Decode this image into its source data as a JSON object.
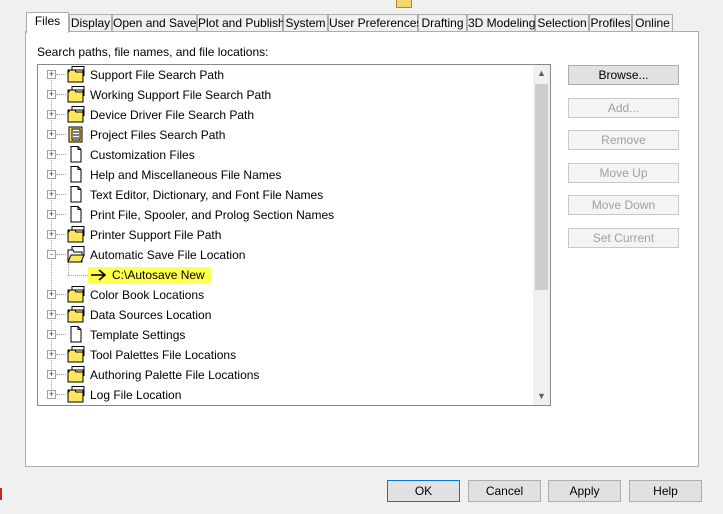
{
  "tabs": [
    {
      "label": "Files",
      "active": true
    },
    {
      "label": "Display",
      "active": false
    },
    {
      "label": "Open and Save",
      "active": false
    },
    {
      "label": "Plot and Publish",
      "active": false
    },
    {
      "label": "System",
      "active": false
    },
    {
      "label": "User Preferences",
      "active": false
    },
    {
      "label": "Drafting",
      "active": false
    },
    {
      "label": "3D Modeling",
      "active": false
    },
    {
      "label": "Selection",
      "active": false
    },
    {
      "label": "Profiles",
      "active": false
    },
    {
      "label": "Online",
      "active": false
    }
  ],
  "files_panel": {
    "label": "Search paths, file names, and file locations:",
    "tree": [
      {
        "label": "Support File Search Path",
        "icon": "folder-stack-icon",
        "expander": "+"
      },
      {
        "label": "Working Support File Search Path",
        "icon": "folder-stack-icon",
        "expander": "+"
      },
      {
        "label": "Device Driver File Search Path",
        "icon": "folder-stack-icon",
        "expander": "+"
      },
      {
        "label": "Project Files Search Path",
        "icon": "project-files-icon",
        "expander": "+"
      },
      {
        "label": "Customization Files",
        "icon": "document-icon",
        "expander": "+"
      },
      {
        "label": "Help and Miscellaneous File Names",
        "icon": "document-icon",
        "expander": "+"
      },
      {
        "label": "Text Editor, Dictionary, and Font File Names",
        "icon": "document-icon",
        "expander": "+"
      },
      {
        "label": "Print File, Spooler, and Prolog Section Names",
        "icon": "document-icon",
        "expander": "+"
      },
      {
        "label": "Printer Support File Path",
        "icon": "folder-stack-icon",
        "expander": "+"
      },
      {
        "label": "Automatic Save File Location",
        "icon": "folder-open-icon",
        "expander": "-"
      },
      {
        "label": "Color Book Locations",
        "icon": "folder-stack-icon",
        "expander": "+"
      },
      {
        "label": "Data Sources Location",
        "icon": "folder-stack-icon",
        "expander": "+"
      },
      {
        "label": "Template Settings",
        "icon": "document-icon",
        "expander": "+"
      },
      {
        "label": "Tool Palettes File Locations",
        "icon": "folder-stack-icon",
        "expander": "+"
      },
      {
        "label": "Authoring Palette File Locations",
        "icon": "folder-stack-icon",
        "expander": "+"
      },
      {
        "label": "Log File Location",
        "icon": "folder-stack-icon",
        "expander": "+"
      }
    ],
    "autosave_child": "C:\\Autosave New"
  },
  "side_buttons": {
    "browse": "Browse...",
    "add": "Add...",
    "remove": "Remove",
    "move_up": "Move Up",
    "move_down": "Move Down",
    "set_current": "Set Current"
  },
  "footer_buttons": {
    "ok": "OK",
    "cancel": "Cancel",
    "apply": "Apply",
    "help": "Help"
  }
}
